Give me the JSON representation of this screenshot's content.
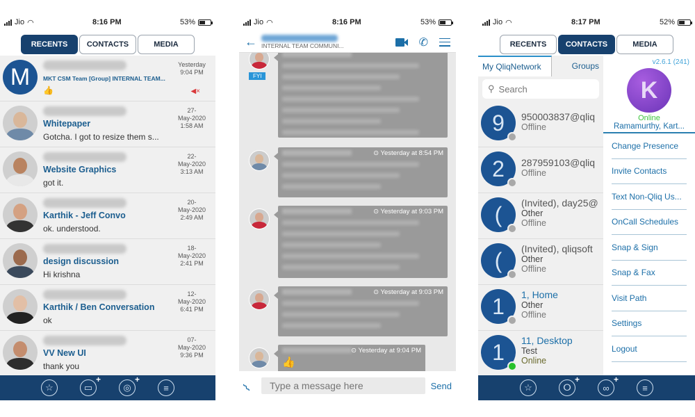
{
  "screens": [
    {
      "status": {
        "carrier": "Jio",
        "time": "8:16 PM",
        "battery": "53%"
      },
      "tabs": [
        {
          "label": "RECENTS",
          "active": true
        },
        {
          "label": "CONTACTS",
          "active": false
        },
        {
          "label": "MEDIA",
          "active": false
        }
      ],
      "recents": [
        {
          "avatar_letter": "M",
          "subject": "MKT CSM Team [Group] INTERNAL TEAM...",
          "preview": "👍",
          "date": [
            "Yesterday",
            "9:04 PM"
          ],
          "muted": true
        },
        {
          "subject": "Whitepaper",
          "preview": "Gotcha. I got to resize them s...",
          "date": [
            "27-",
            "May-2020",
            "1:58 AM"
          ]
        },
        {
          "subject": "Website Graphics",
          "preview": "got it.",
          "date": [
            "22-",
            "May-2020",
            "3:13 AM"
          ]
        },
        {
          "subject": "Karthik - Jeff Convo",
          "preview": "ok. understood.",
          "date": [
            "20-",
            "May-2020",
            "2:49 AM"
          ]
        },
        {
          "subject": "design discussion",
          "preview": "Hi krishna",
          "date": [
            "18-",
            "May-2020",
            "2:41 PM"
          ]
        },
        {
          "subject": "Karthik / Ben Conversation",
          "preview": "ok",
          "date": [
            "12-",
            "May-2020",
            "6:41 PM"
          ]
        },
        {
          "subject": "VV New UI",
          "preview": "thank you",
          "date": [
            "07-",
            "May-2020",
            "9:36 PM"
          ]
        }
      ],
      "tabbar": [
        "favorites",
        "new-chat",
        "new-media",
        "menu"
      ]
    },
    {
      "status": {
        "carrier": "Jio",
        "time": "8:16 PM",
        "battery": "53%"
      },
      "chat": {
        "subtitle": "INTERNAL TEAM COMMUNI...",
        "fyi_label": "FYI",
        "messages": [
          {
            "timestamp": "",
            "lines": 7,
            "fyi": true
          },
          {
            "timestamp": "Yesterday at 8:54 PM",
            "lines": 3
          },
          {
            "timestamp": "Yesterday at 9:03 PM",
            "lines": 5
          },
          {
            "timestamp": "Yesterday at 9:03 PM",
            "lines": 3
          },
          {
            "timestamp": "Yesterday at 9:04 PM",
            "emoji": "👍"
          }
        ],
        "input_placeholder": "Type a message here",
        "send_label": "Send"
      }
    },
    {
      "status": {
        "carrier": "Jio",
        "time": "8:17 PM",
        "battery": "52%"
      },
      "tabs": [
        {
          "label": "RECENTS",
          "active": false
        },
        {
          "label": "CONTACTS",
          "active": true
        },
        {
          "label": "MEDIA",
          "active": false
        }
      ],
      "subtabs": {
        "network": "My QliqNetwork",
        "groups": "Groups"
      },
      "search_placeholder": "Search",
      "contacts": [
        {
          "initial": "9",
          "name": "950003837@qliq",
          "type": "",
          "status": "Offline",
          "online": false
        },
        {
          "initial": "2",
          "name": "287959103@qliq",
          "type": "",
          "status": "Offline",
          "online": false
        },
        {
          "initial": "(",
          "name": "(Invited), day25@",
          "type": "Other",
          "status": "Offline",
          "online": false
        },
        {
          "initial": "(",
          "name": "(Invited), qliqsoft",
          "type": "Other",
          "status": "Offline",
          "online": false
        },
        {
          "initial": "1",
          "name": "1, Home",
          "type": "Other",
          "status": "Offline",
          "online": false
        },
        {
          "initial": "1",
          "name": "11, Desktop",
          "type": "Test",
          "status": "Online",
          "online": true
        }
      ],
      "drawer": {
        "version": "v2.6.1 (241)",
        "avatar_letter": "K",
        "presence": "Online",
        "user_name": "Ramamurthy, Kart...",
        "menu": [
          "Change Presence",
          "Invite Contacts",
          "Text Non-Qliq Us...",
          "OnCall Schedules",
          "Snap & Sign",
          "Snap & Fax",
          "Visit Path",
          "Settings",
          "Logout"
        ]
      },
      "tabbar": [
        "favorites",
        "add-contact",
        "add-group",
        "menu"
      ]
    }
  ],
  "colors": {
    "brand_navy": "#17416e",
    "link_blue": "#1c6fa8",
    "online_green": "#27c12b",
    "offline_gray": "#a9a9a9",
    "mute_red": "#d9383a"
  }
}
